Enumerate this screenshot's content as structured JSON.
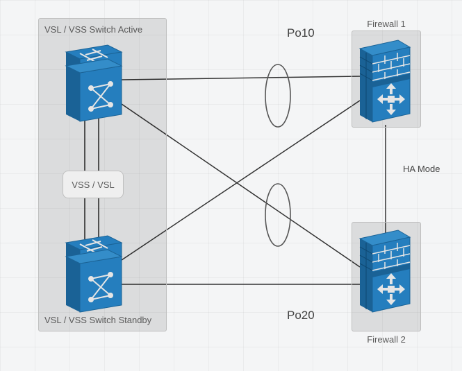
{
  "diagram": {
    "groups": {
      "switches": {
        "label": "VSL / VSS Switch  Active",
        "standby_label": "VSL / VSS Switch Standby"
      },
      "firewall1": {
        "label": "Firewall 1"
      },
      "firewall2": {
        "label": "Firewall 2"
      }
    },
    "vss_box": {
      "label": "VSS / VSL"
    },
    "labels": {
      "po10": "Po10",
      "po20": "Po20",
      "ha": "HA Mode"
    },
    "nodes": {
      "switch_active": {
        "type": "l3-switch"
      },
      "switch_standby": {
        "type": "l3-switch"
      },
      "firewall_top": {
        "type": "firewall"
      },
      "firewall_bottom": {
        "type": "firewall"
      }
    },
    "port_channels": [
      "Po10",
      "Po20"
    ],
    "topology": {
      "description": "Two VSS/VSL-paired L3 switches (active/standby) cross-connect to two firewalls in HA mode via port-channels Po10 and Po20.",
      "links": [
        {
          "a": "switch_active",
          "b": "firewall_top",
          "bundle": "Po10"
        },
        {
          "a": "switch_active",
          "b": "firewall_bottom",
          "bundle": "Po20"
        },
        {
          "a": "switch_standby",
          "b": "firewall_top",
          "bundle": "Po10"
        },
        {
          "a": "switch_standby",
          "b": "firewall_bottom",
          "bundle": "Po20"
        },
        {
          "a": "switch_active",
          "b": "switch_standby",
          "via": "VSS/VSL",
          "count": 2
        },
        {
          "a": "firewall_top",
          "b": "firewall_bottom",
          "via": "HA"
        }
      ]
    }
  }
}
